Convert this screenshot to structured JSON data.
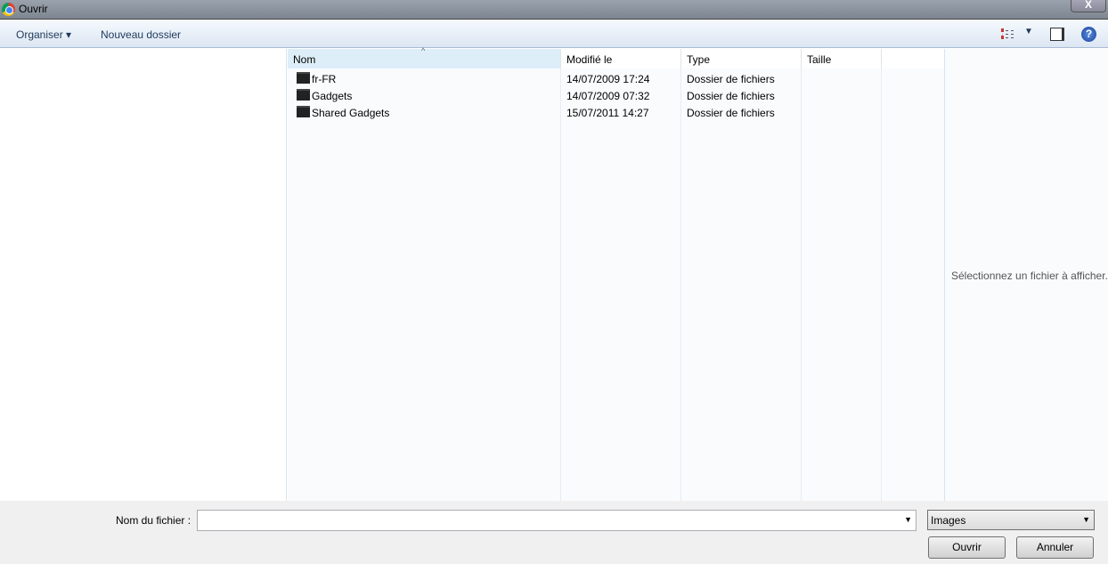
{
  "window": {
    "title": "Ouvrir",
    "close": "X"
  },
  "toolbar": {
    "organise": "Organiser ▾",
    "new_folder": "Nouveau dossier",
    "view_dropdown": "▼",
    "help": "?"
  },
  "columns": [
    "Nom",
    "Modifié le",
    "Type",
    "Taille"
  ],
  "sort_indicator": "^",
  "files": [
    {
      "name": "fr-FR",
      "modified": "14/07/2009 17:24",
      "type": "Dossier de fichiers"
    },
    {
      "name": "Gadgets",
      "modified": "14/07/2009 07:32",
      "type": "Dossier de fichiers"
    },
    {
      "name": "Shared Gadgets",
      "modified": "15/07/2011 14:27",
      "type": "Dossier de fichiers"
    }
  ],
  "preview": {
    "message": "Sélectionnez un fichier à afficher."
  },
  "bottom": {
    "filename_label": "Nom du fichier :",
    "filename_value": "",
    "filter": "Images",
    "open": "Ouvrir",
    "cancel": "Annuler",
    "arrow": "▼"
  }
}
